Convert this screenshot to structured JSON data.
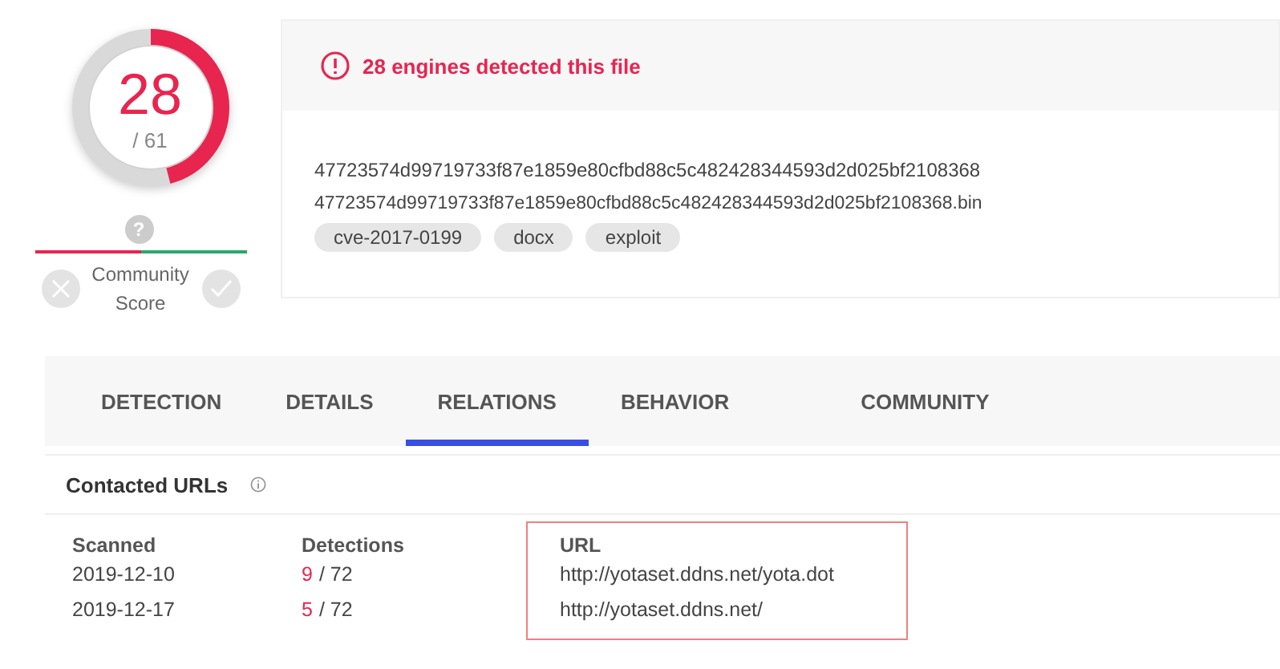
{
  "score": {
    "detected": "28",
    "total": "/ 61"
  },
  "community": {
    "icon": "?",
    "label": "Community Score"
  },
  "summary": {
    "alert": "28 engines detected this file",
    "hash": "47723574d99719733f87e1859e80cfbd88c5c482428344593d2d025bf2108368",
    "filename": "47723574d99719733f87e1859e80cfbd88c5c482428344593d2d025bf2108368.bin",
    "tags": [
      "cve-2017-0199",
      "docx",
      "exploit"
    ]
  },
  "tabs": [
    {
      "label": "DETECTION",
      "selected": false
    },
    {
      "label": "DETAILS",
      "selected": false
    },
    {
      "label": "RELATIONS",
      "selected": true
    },
    {
      "label": "BEHAVIOR",
      "selected": false
    },
    {
      "label": "COMMUNITY",
      "selected": false
    }
  ],
  "section": {
    "title": "Contacted URLs"
  },
  "table": {
    "columns": [
      {
        "label": "Scanned",
        "highlighted": false
      },
      {
        "label": "Detections",
        "highlighted": false
      },
      {
        "label": "URL",
        "highlighted": true
      }
    ],
    "rows": [
      {
        "scanned": "2019-12-10",
        "positives": "9",
        "total": "/ 72",
        "url": "http://yotaset.ddns.net/yota.dot"
      },
      {
        "scanned": "2019-12-17",
        "positives": "5",
        "total": "/ 72",
        "url": "http://yotaset.ddns.net/"
      }
    ]
  }
}
